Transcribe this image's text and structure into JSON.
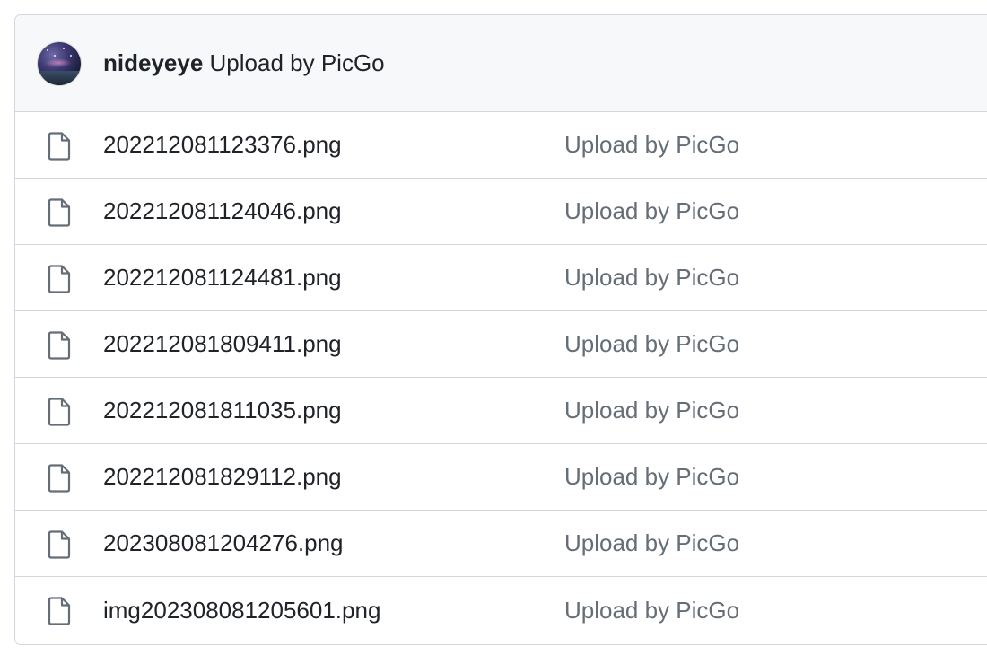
{
  "commit": {
    "author": "nideyeye",
    "message": "Upload by PicGo",
    "avatar_icon": "avatar-night-sky"
  },
  "files": [
    {
      "name": "202212081123376.png",
      "message": "Upload by PicGo",
      "icon": "file-icon"
    },
    {
      "name": "202212081124046.png",
      "message": "Upload by PicGo",
      "icon": "file-icon"
    },
    {
      "name": "202212081124481.png",
      "message": "Upload by PicGo",
      "icon": "file-icon"
    },
    {
      "name": "202212081809411.png",
      "message": "Upload by PicGo",
      "icon": "file-icon"
    },
    {
      "name": "202212081811035.png",
      "message": "Upload by PicGo",
      "icon": "file-icon"
    },
    {
      "name": "202212081829112.png",
      "message": "Upload by PicGo",
      "icon": "file-icon"
    },
    {
      "name": "202308081204276.png",
      "message": "Upload by PicGo",
      "icon": "file-icon"
    },
    {
      "name": "img202308081205601.png",
      "message": "Upload by PicGo",
      "icon": "file-icon"
    }
  ],
  "colors": {
    "border": "#d0d7de",
    "header_bg": "#f6f8fa",
    "text": "#1f2328",
    "muted": "#656d76"
  }
}
